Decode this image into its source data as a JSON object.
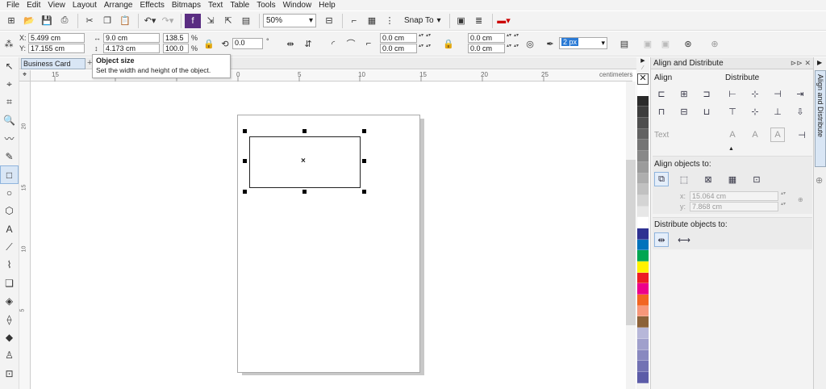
{
  "menu": [
    "File",
    "Edit",
    "View",
    "Layout",
    "Arrange",
    "Effects",
    "Bitmaps",
    "Text",
    "Table",
    "Tools",
    "Window",
    "Help"
  ],
  "standard_toolbar": {
    "zoom": "50%",
    "snap_to": "Snap To"
  },
  "property_bar": {
    "x": "5.499 cm",
    "y": "17.155 cm",
    "width": "9.0 cm",
    "height": "4.173 cm",
    "scale_w": "138.5",
    "scale_h": "100.0",
    "pct": "%",
    "rotation": "0.0",
    "deg": "°",
    "corner_1": "0.0 cm",
    "corner_2": "0.0 cm",
    "corner_3": "0.0 cm",
    "corner_4": "0.0 cm",
    "outline_width": "2 px"
  },
  "tooltip": {
    "title": "Object size",
    "text": "Set the width and height of the object."
  },
  "document": {
    "tab": "Business Card",
    "ruler_units": "centimeters",
    "h_ticks": [
      "15",
      "10",
      "5",
      "0",
      "5",
      "10",
      "15",
      "20",
      "25"
    ],
    "v_ticks": [
      "20",
      "15",
      "10",
      "5"
    ]
  },
  "docker": {
    "title": "Align and Distribute",
    "align_heading": "Align",
    "distribute_heading": "Distribute",
    "text_label": "Text",
    "align_objects_to": "Align objects to:",
    "x_value": "15.064 cm",
    "y_value": "7.868 cm",
    "x_label": "x:",
    "y_label": "y:",
    "distribute_objects_to": "Distribute objects to:",
    "vertical_tab": "Align and Distribute"
  },
  "palette_colors": [
    "#ffffff",
    "#2b2b2b",
    "#3d3d3d",
    "#4f4f4f",
    "#626262",
    "#757575",
    "#888888",
    "#9b9b9b",
    "#aeaeae",
    "#c1c1c1",
    "#d4d4d4",
    "#e7e7e7",
    "#ffffff",
    "#2e3192",
    "#0072bc",
    "#00a651",
    "#fff200",
    "#ed1c24",
    "#ec008c",
    "#f26522",
    "#f7977a",
    "#8c6239",
    "#b7b7d9",
    "#a0a0cc",
    "#8989c0",
    "#7272b4",
    "#5c5ca8"
  ],
  "accent": "#2a7ad5"
}
